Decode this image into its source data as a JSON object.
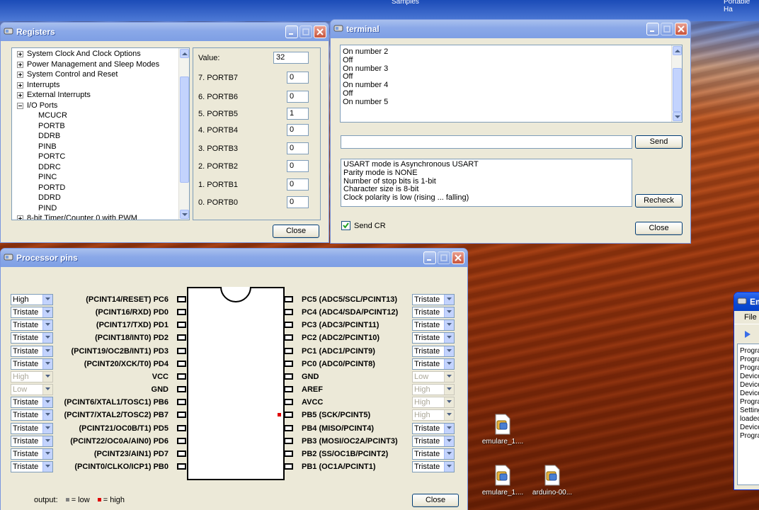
{
  "desktop": {
    "top_fragments": [
      "Samples",
      "Portable Ha"
    ],
    "icons": [
      {
        "label": "emulare_1...."
      },
      {
        "label": "emulare_1...."
      },
      {
        "label": "arduino-00..."
      }
    ]
  },
  "registers": {
    "title": "Registers",
    "tree": [
      {
        "label": "System Clock And Clock Options",
        "expander": "+"
      },
      {
        "label": "Power Management and Sleep Modes",
        "expander": "+"
      },
      {
        "label": "System Control and Reset",
        "expander": "+"
      },
      {
        "label": "Interrupts",
        "expander": "+"
      },
      {
        "label": "External Interrupts",
        "expander": "+"
      },
      {
        "label": "I/O Ports",
        "expander": "-"
      },
      {
        "label": "MCUCR",
        "expander": ""
      },
      {
        "label": "PORTB",
        "expander": ""
      },
      {
        "label": "DDRB",
        "expander": ""
      },
      {
        "label": "PINB",
        "expander": ""
      },
      {
        "label": "PORTC",
        "expander": ""
      },
      {
        "label": "DDRC",
        "expander": ""
      },
      {
        "label": "PINC",
        "expander": ""
      },
      {
        "label": "PORTD",
        "expander": ""
      },
      {
        "label": "DDRD",
        "expander": ""
      },
      {
        "label": "PIND",
        "expander": ""
      },
      {
        "label": "8-bit Timer/Counter 0 with PWM",
        "expander": "+"
      }
    ],
    "value_label": "Value:",
    "value": "32",
    "bits": [
      {
        "name": "7.  PORTB7",
        "value": "0"
      },
      {
        "name": "6.  PORTB6",
        "value": "0"
      },
      {
        "name": "5.  PORTB5",
        "value": "1"
      },
      {
        "name": "4.  PORTB4",
        "value": "0"
      },
      {
        "name": "3.  PORTB3",
        "value": "0"
      },
      {
        "name": "2.  PORTB2",
        "value": "0"
      },
      {
        "name": "1.  PORTB1",
        "value": "0"
      },
      {
        "name": "0.  PORTB0",
        "value": "0"
      }
    ],
    "close_label": "Close"
  },
  "terminal": {
    "title": "terminal",
    "output_text": "On number 2\nOff\nOn number 3\nOff\nOn number 4\nOff\nOn number 5",
    "input_value": "",
    "send_label": "Send",
    "status_text": "USART mode is Asynchronous USART\nParity mode is NONE\nNumber of stop bits is 1-bit\nCharacter size is 8-bit\nClock polarity is low (rising ... falling)",
    "recheck_label": "Recheck",
    "send_cr_label": "Send CR",
    "send_cr_checked": true,
    "close_label": "Close"
  },
  "processor_pins": {
    "title": "Processor pins",
    "left_pins": [
      {
        "label": "(PCINT14/RESET)  PC6",
        "select": "High",
        "enabled": true
      },
      {
        "label": "(PCINT16/RXD)  PD0",
        "select": "Tristate",
        "enabled": true
      },
      {
        "label": "(PCINT17/TXD)  PD1",
        "select": "Tristate",
        "enabled": true
      },
      {
        "label": "(PCINT18/INT0)  PD2",
        "select": "Tristate",
        "enabled": true
      },
      {
        "label": "(PCINT19/OC2B/INT1)  PD3",
        "select": "Tristate",
        "enabled": true
      },
      {
        "label": "(PCINT20/XCK/T0)  PD4",
        "select": "Tristate",
        "enabled": true
      },
      {
        "label": "VCC",
        "select": "High",
        "enabled": false
      },
      {
        "label": "GND",
        "select": "Low",
        "enabled": false
      },
      {
        "label": "(PCINT6/XTAL1/TOSC1)  PB6",
        "select": "Tristate",
        "enabled": true
      },
      {
        "label": "(PCINT7/XTAL2/TOSC2)  PB7",
        "select": "Tristate",
        "enabled": true
      },
      {
        "label": "(PCINT21/OC0B/T1)  PD5",
        "select": "Tristate",
        "enabled": true
      },
      {
        "label": "(PCINT22/OC0A/AIN0)  PD6",
        "select": "Tristate",
        "enabled": true
      },
      {
        "label": "(PCINT23/AIN1)  PD7",
        "select": "Tristate",
        "enabled": true
      },
      {
        "label": "(PCINT0/CLKO/ICP1)  PB0",
        "select": "Tristate",
        "enabled": true
      }
    ],
    "right_pins": [
      {
        "label": "PC5  (ADC5/SCL/PCINT13)",
        "select": "Tristate",
        "enabled": true,
        "level": "none"
      },
      {
        "label": "PC4  (ADC4/SDA/PCINT12)",
        "select": "Tristate",
        "enabled": true,
        "level": "none"
      },
      {
        "label": "PC3  (ADC3/PCINT11)",
        "select": "Tristate",
        "enabled": true,
        "level": "none"
      },
      {
        "label": "PC2  (ADC2/PCINT10)",
        "select": "Tristate",
        "enabled": true,
        "level": "none"
      },
      {
        "label": "PC1  (ADC1/PCINT9)",
        "select": "Tristate",
        "enabled": true,
        "level": "none"
      },
      {
        "label": "PC0  (ADC0/PCINT8)",
        "select": "Tristate",
        "enabled": true,
        "level": "none"
      },
      {
        "label": "GND",
        "select": "Low",
        "enabled": false,
        "level": "none"
      },
      {
        "label": "AREF",
        "select": "High",
        "enabled": false,
        "level": "none"
      },
      {
        "label": "AVCC",
        "select": "High",
        "enabled": false,
        "level": "none"
      },
      {
        "label": "PB5  (SCK/PCINT5)",
        "select": "High",
        "enabled": false,
        "level": "high"
      },
      {
        "label": "PB4  (MISO/PCINT4)",
        "select": "Tristate",
        "enabled": true,
        "level": "none"
      },
      {
        "label": "PB3  (MOSI/OC2A/PCINT3)",
        "select": "Tristate",
        "enabled": true,
        "level": "none"
      },
      {
        "label": "PB2  (SS/OC1B/PCINT2)",
        "select": "Tristate",
        "enabled": true,
        "level": "none"
      },
      {
        "label": "PB1  (OC1A/PCINT1)",
        "select": "Tristate",
        "enabled": true,
        "level": "none"
      }
    ],
    "legend": {
      "prefix": "output:",
      "low": "= low",
      "high": "= high"
    },
    "colors": {
      "low": "#808080",
      "high": "#e00000"
    },
    "close_label": "Close"
  },
  "emulare": {
    "title_fragment": "Em",
    "menu_file": "File",
    "log_lines": [
      "Progra",
      "Progra",
      "Progra",
      "Device",
      "Device",
      "Device",
      "Progra",
      "Setting",
      "loadec",
      "Device",
      "Progra"
    ]
  }
}
